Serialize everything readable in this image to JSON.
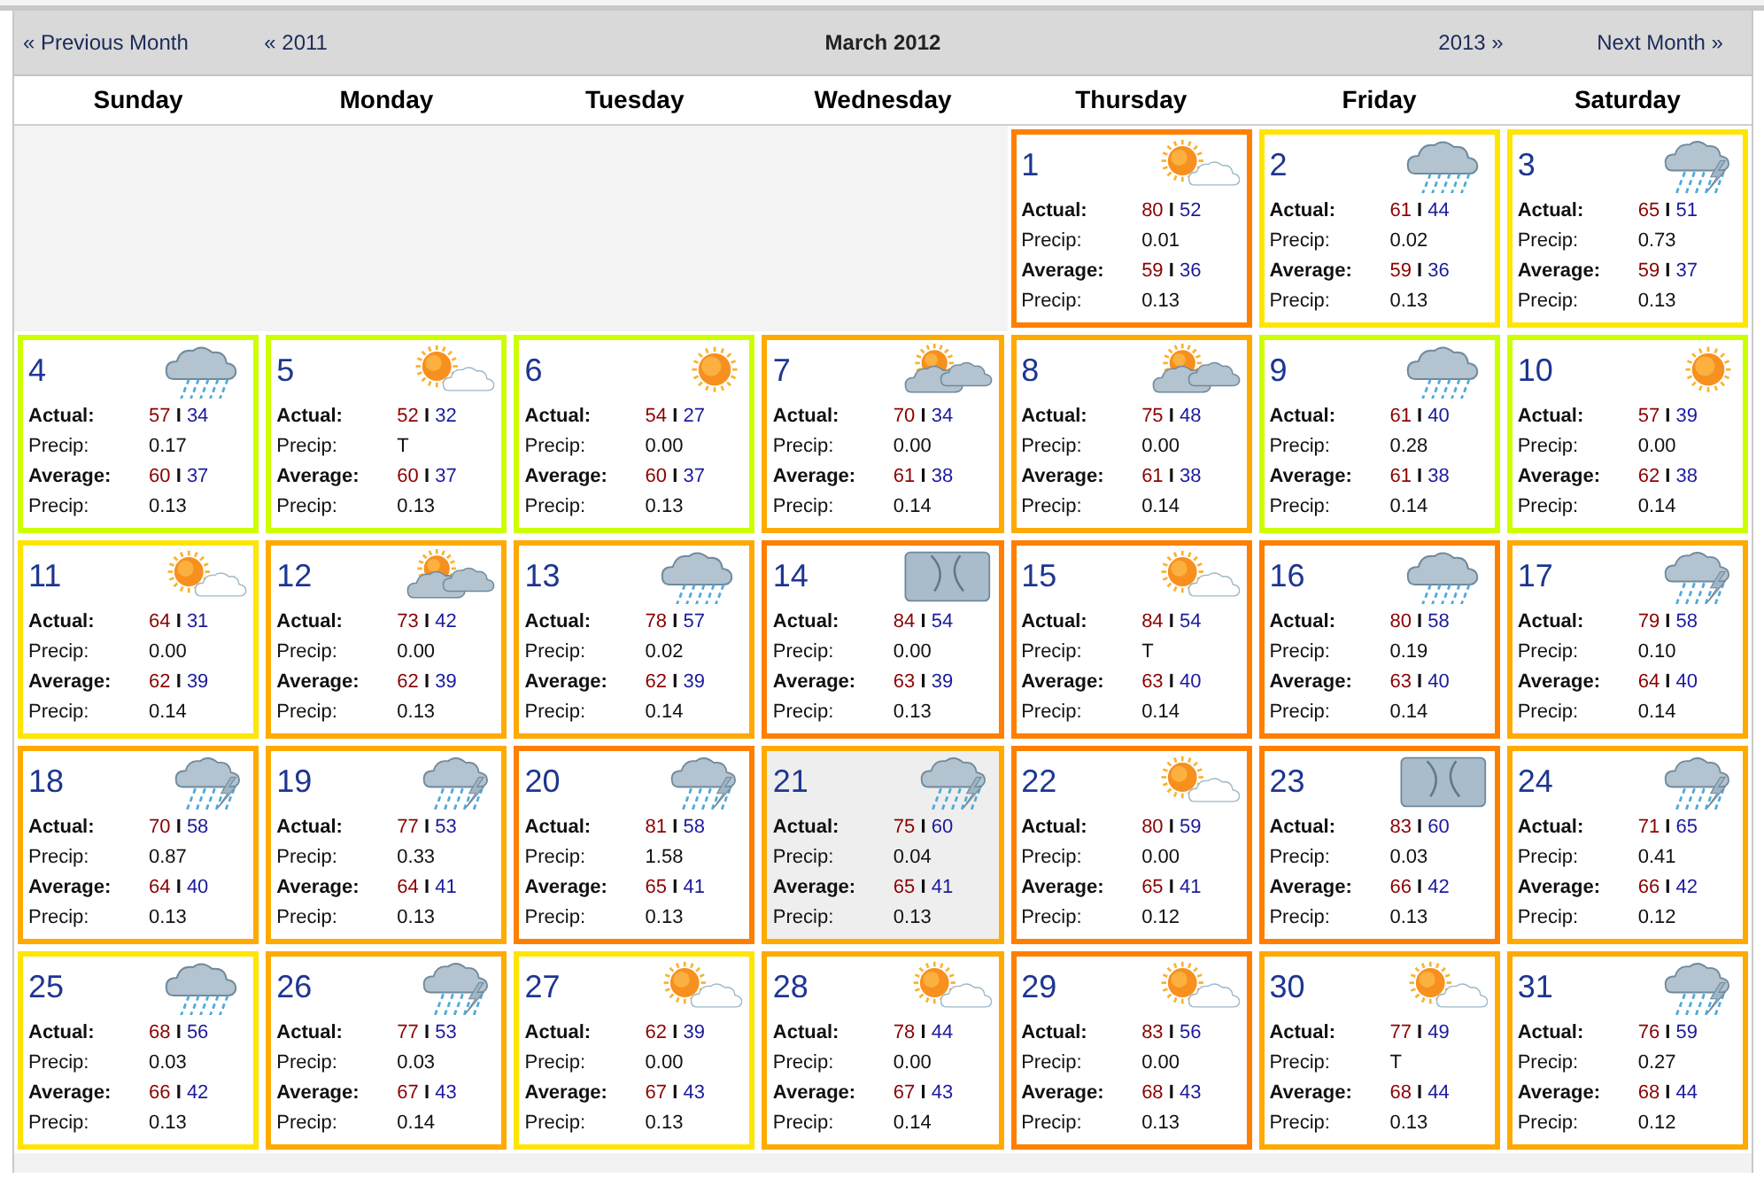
{
  "nav": {
    "prev_month": "« Previous Month",
    "prev_year": "« 2011",
    "title": "March 2012",
    "next_year": "2013 »",
    "next_month": "Next Month »"
  },
  "weekdays": [
    "Sunday",
    "Monday",
    "Tuesday",
    "Wednesday",
    "Thursday",
    "Friday",
    "Saturday"
  ],
  "cells": [
    {
      "kind": "blank"
    },
    {
      "kind": "blank"
    },
    {
      "kind": "blank"
    },
    {
      "kind": "blank"
    },
    {
      "kind": "sun-cloud",
      "day": "1",
      "color": "#ff7f00",
      "selected": false,
      "rows": [
        {
          "kind": "temps",
          "label": "Actual:",
          "hi": "80",
          "sep": "I",
          "lo": "52"
        },
        {
          "kind": "precip",
          "label": "Precip:",
          "value": "0.01"
        },
        {
          "kind": "temps",
          "label": "Average:",
          "hi": "59",
          "sep": "I",
          "lo": "36"
        },
        {
          "kind": "precip",
          "label": "Precip:",
          "value": "0.13"
        }
      ]
    },
    {
      "kind": "rain",
      "day": "2",
      "color": "#ffe500",
      "selected": false,
      "rows": [
        {
          "kind": "temps",
          "label": "Actual:",
          "hi": "61",
          "sep": "I",
          "lo": "44"
        },
        {
          "kind": "precip",
          "label": "Precip:",
          "value": "0.02"
        },
        {
          "kind": "temps",
          "label": "Average:",
          "hi": "59",
          "sep": "I",
          "lo": "36"
        },
        {
          "kind": "precip",
          "label": "Precip:",
          "value": "0.13"
        }
      ]
    },
    {
      "kind": "storm",
      "day": "3",
      "color": "#ffe500",
      "selected": false,
      "rows": [
        {
          "kind": "temps",
          "label": "Actual:",
          "hi": "65",
          "sep": "I",
          "lo": "51"
        },
        {
          "kind": "precip",
          "label": "Precip:",
          "value": "0.73"
        },
        {
          "kind": "temps",
          "label": "Average:",
          "hi": "59",
          "sep": "I",
          "lo": "37"
        },
        {
          "kind": "precip",
          "label": "Precip:",
          "value": "0.13"
        }
      ]
    },
    {
      "kind": "rain",
      "day": "4",
      "color": "#ccff00",
      "selected": false,
      "rows": [
        {
          "kind": "temps",
          "label": "Actual:",
          "hi": "57",
          "sep": "I",
          "lo": "34"
        },
        {
          "kind": "precip",
          "label": "Precip:",
          "value": "0.17"
        },
        {
          "kind": "temps",
          "label": "Average:",
          "hi": "60",
          "sep": "I",
          "lo": "37"
        },
        {
          "kind": "precip",
          "label": "Precip:",
          "value": "0.13"
        }
      ]
    },
    {
      "kind": "sun-cloud",
      "day": "5",
      "color": "#ccff00",
      "selected": false,
      "rows": [
        {
          "kind": "temps",
          "label": "Actual:",
          "hi": "52",
          "sep": "I",
          "lo": "32"
        },
        {
          "kind": "precip",
          "label": "Precip:",
          "value": "T"
        },
        {
          "kind": "temps",
          "label": "Average:",
          "hi": "60",
          "sep": "I",
          "lo": "37"
        },
        {
          "kind": "precip",
          "label": "Precip:",
          "value": "0.13"
        }
      ]
    },
    {
      "kind": "sun",
      "day": "6",
      "color": "#ccff00",
      "selected": false,
      "rows": [
        {
          "kind": "temps",
          "label": "Actual:",
          "hi": "54",
          "sep": "I",
          "lo": "27"
        },
        {
          "kind": "precip",
          "label": "Precip:",
          "value": "0.00"
        },
        {
          "kind": "temps",
          "label": "Average:",
          "hi": "60",
          "sep": "I",
          "lo": "37"
        },
        {
          "kind": "precip",
          "label": "Precip:",
          "value": "0.13"
        }
      ]
    },
    {
      "kind": "partly-cloudy",
      "day": "7",
      "color": "#ffaa00",
      "selected": false,
      "rows": [
        {
          "kind": "temps",
          "label": "Actual:",
          "hi": "70",
          "sep": "I",
          "lo": "34"
        },
        {
          "kind": "precip",
          "label": "Precip:",
          "value": "0.00"
        },
        {
          "kind": "temps",
          "label": "Average:",
          "hi": "61",
          "sep": "I",
          "lo": "38"
        },
        {
          "kind": "precip",
          "label": "Precip:",
          "value": "0.14"
        }
      ]
    },
    {
      "kind": "partly-cloudy",
      "day": "8",
      "color": "#ffaa00",
      "selected": false,
      "rows": [
        {
          "kind": "temps",
          "label": "Actual:",
          "hi": "75",
          "sep": "I",
          "lo": "48"
        },
        {
          "kind": "precip",
          "label": "Precip:",
          "value": "0.00"
        },
        {
          "kind": "temps",
          "label": "Average:",
          "hi": "61",
          "sep": "I",
          "lo": "38"
        },
        {
          "kind": "precip",
          "label": "Precip:",
          "value": "0.14"
        }
      ]
    },
    {
      "kind": "rain",
      "day": "9",
      "color": "#ccff00",
      "selected": false,
      "rows": [
        {
          "kind": "temps",
          "label": "Actual:",
          "hi": "61",
          "sep": "I",
          "lo": "40"
        },
        {
          "kind": "precip",
          "label": "Precip:",
          "value": "0.28"
        },
        {
          "kind": "temps",
          "label": "Average:",
          "hi": "61",
          "sep": "I",
          "lo": "38"
        },
        {
          "kind": "precip",
          "label": "Precip:",
          "value": "0.14"
        }
      ]
    },
    {
      "kind": "sun",
      "day": "10",
      "color": "#ccff00",
      "selected": false,
      "rows": [
        {
          "kind": "temps",
          "label": "Actual:",
          "hi": "57",
          "sep": "I",
          "lo": "39"
        },
        {
          "kind": "precip",
          "label": "Precip:",
          "value": "0.00"
        },
        {
          "kind": "temps",
          "label": "Average:",
          "hi": "62",
          "sep": "I",
          "lo": "38"
        },
        {
          "kind": "precip",
          "label": "Precip:",
          "value": "0.14"
        }
      ]
    },
    {
      "kind": "sun-cloud",
      "day": "11",
      "color": "#ffe500",
      "selected": false,
      "rows": [
        {
          "kind": "temps",
          "label": "Actual:",
          "hi": "64",
          "sep": "I",
          "lo": "31"
        },
        {
          "kind": "precip",
          "label": "Precip:",
          "value": "0.00"
        },
        {
          "kind": "temps",
          "label": "Average:",
          "hi": "62",
          "sep": "I",
          "lo": "39"
        },
        {
          "kind": "precip",
          "label": "Precip:",
          "value": "0.14"
        }
      ]
    },
    {
      "kind": "partly-cloudy",
      "day": "12",
      "color": "#ffaa00",
      "selected": false,
      "rows": [
        {
          "kind": "temps",
          "label": "Actual:",
          "hi": "73",
          "sep": "I",
          "lo": "42"
        },
        {
          "kind": "precip",
          "label": "Precip:",
          "value": "0.00"
        },
        {
          "kind": "temps",
          "label": "Average:",
          "hi": "62",
          "sep": "I",
          "lo": "39"
        },
        {
          "kind": "precip",
          "label": "Precip:",
          "value": "0.13"
        }
      ]
    },
    {
      "kind": "rain",
      "day": "13",
      "color": "#ffaa00",
      "selected": false,
      "rows": [
        {
          "kind": "temps",
          "label": "Actual:",
          "hi": "78",
          "sep": "I",
          "lo": "57"
        },
        {
          "kind": "precip",
          "label": "Precip:",
          "value": "0.02"
        },
        {
          "kind": "temps",
          "label": "Average:",
          "hi": "62",
          "sep": "I",
          "lo": "39"
        },
        {
          "kind": "precip",
          "label": "Precip:",
          "value": "0.14"
        }
      ]
    },
    {
      "kind": "overcast",
      "day": "14",
      "color": "#ff7f00",
      "selected": false,
      "rows": [
        {
          "kind": "temps",
          "label": "Actual:",
          "hi": "84",
          "sep": "I",
          "lo": "54"
        },
        {
          "kind": "precip",
          "label": "Precip:",
          "value": "0.00"
        },
        {
          "kind": "temps",
          "label": "Average:",
          "hi": "63",
          "sep": "I",
          "lo": "39"
        },
        {
          "kind": "precip",
          "label": "Precip:",
          "value": "0.13"
        }
      ]
    },
    {
      "kind": "sun-cloud",
      "day": "15",
      "color": "#ff7f00",
      "selected": false,
      "rows": [
        {
          "kind": "temps",
          "label": "Actual:",
          "hi": "84",
          "sep": "I",
          "lo": "54"
        },
        {
          "kind": "precip",
          "label": "Precip:",
          "value": "T"
        },
        {
          "kind": "temps",
          "label": "Average:",
          "hi": "63",
          "sep": "I",
          "lo": "40"
        },
        {
          "kind": "precip",
          "label": "Precip:",
          "value": "0.14"
        }
      ]
    },
    {
      "kind": "rain",
      "day": "16",
      "color": "#ff7f00",
      "selected": false,
      "rows": [
        {
          "kind": "temps",
          "label": "Actual:",
          "hi": "80",
          "sep": "I",
          "lo": "58"
        },
        {
          "kind": "precip",
          "label": "Precip:",
          "value": "0.19"
        },
        {
          "kind": "temps",
          "label": "Average:",
          "hi": "63",
          "sep": "I",
          "lo": "40"
        },
        {
          "kind": "precip",
          "label": "Precip:",
          "value": "0.14"
        }
      ]
    },
    {
      "kind": "storm",
      "day": "17",
      "color": "#ffaa00",
      "selected": false,
      "rows": [
        {
          "kind": "temps",
          "label": "Actual:",
          "hi": "79",
          "sep": "I",
          "lo": "58"
        },
        {
          "kind": "precip",
          "label": "Precip:",
          "value": "0.10"
        },
        {
          "kind": "temps",
          "label": "Average:",
          "hi": "64",
          "sep": "I",
          "lo": "40"
        },
        {
          "kind": "precip",
          "label": "Precip:",
          "value": "0.14"
        }
      ]
    },
    {
      "kind": "storm",
      "day": "18",
      "color": "#ffaa00",
      "selected": false,
      "rows": [
        {
          "kind": "temps",
          "label": "Actual:",
          "hi": "70",
          "sep": "I",
          "lo": "58"
        },
        {
          "kind": "precip",
          "label": "Precip:",
          "value": "0.87"
        },
        {
          "kind": "temps",
          "label": "Average:",
          "hi": "64",
          "sep": "I",
          "lo": "40"
        },
        {
          "kind": "precip",
          "label": "Precip:",
          "value": "0.13"
        }
      ]
    },
    {
      "kind": "storm",
      "day": "19",
      "color": "#ffaa00",
      "selected": false,
      "rows": [
        {
          "kind": "temps",
          "label": "Actual:",
          "hi": "77",
          "sep": "I",
          "lo": "53"
        },
        {
          "kind": "precip",
          "label": "Precip:",
          "value": "0.33"
        },
        {
          "kind": "temps",
          "label": "Average:",
          "hi": "64",
          "sep": "I",
          "lo": "41"
        },
        {
          "kind": "precip",
          "label": "Precip:",
          "value": "0.13"
        }
      ]
    },
    {
      "kind": "storm",
      "day": "20",
      "color": "#ff7f00",
      "selected": false,
      "rows": [
        {
          "kind": "temps",
          "label": "Actual:",
          "hi": "81",
          "sep": "I",
          "lo": "58"
        },
        {
          "kind": "precip",
          "label": "Precip:",
          "value": "1.58"
        },
        {
          "kind": "temps",
          "label": "Average:",
          "hi": "65",
          "sep": "I",
          "lo": "41"
        },
        {
          "kind": "precip",
          "label": "Precip:",
          "value": "0.13"
        }
      ]
    },
    {
      "kind": "storm",
      "day": "21",
      "color": "#ffaa00",
      "selected": true,
      "rows": [
        {
          "kind": "temps",
          "label": "Actual:",
          "hi": "75",
          "sep": "I",
          "lo": "60"
        },
        {
          "kind": "precip",
          "label": "Precip:",
          "value": "0.04"
        },
        {
          "kind": "temps",
          "label": "Average:",
          "hi": "65",
          "sep": "I",
          "lo": "41"
        },
        {
          "kind": "precip",
          "label": "Precip:",
          "value": "0.13"
        }
      ]
    },
    {
      "kind": "sun-cloud",
      "day": "22",
      "color": "#ff7f00",
      "selected": false,
      "rows": [
        {
          "kind": "temps",
          "label": "Actual:",
          "hi": "80",
          "sep": "I",
          "lo": "59"
        },
        {
          "kind": "precip",
          "label": "Precip:",
          "value": "0.00"
        },
        {
          "kind": "temps",
          "label": "Average:",
          "hi": "65",
          "sep": "I",
          "lo": "41"
        },
        {
          "kind": "precip",
          "label": "Precip:",
          "value": "0.12"
        }
      ]
    },
    {
      "kind": "overcast",
      "day": "23",
      "color": "#ff7f00",
      "selected": false,
      "rows": [
        {
          "kind": "temps",
          "label": "Actual:",
          "hi": "83",
          "sep": "I",
          "lo": "60"
        },
        {
          "kind": "precip",
          "label": "Precip:",
          "value": "0.03"
        },
        {
          "kind": "temps",
          "label": "Average:",
          "hi": "66",
          "sep": "I",
          "lo": "42"
        },
        {
          "kind": "precip",
          "label": "Precip:",
          "value": "0.13"
        }
      ]
    },
    {
      "kind": "storm",
      "day": "24",
      "color": "#ffaa00",
      "selected": false,
      "rows": [
        {
          "kind": "temps",
          "label": "Actual:",
          "hi": "71",
          "sep": "I",
          "lo": "65"
        },
        {
          "kind": "precip",
          "label": "Precip:",
          "value": "0.41"
        },
        {
          "kind": "temps",
          "label": "Average:",
          "hi": "66",
          "sep": "I",
          "lo": "42"
        },
        {
          "kind": "precip",
          "label": "Precip:",
          "value": "0.12"
        }
      ]
    },
    {
      "kind": "rain",
      "day": "25",
      "color": "#ffe500",
      "selected": false,
      "rows": [
        {
          "kind": "temps",
          "label": "Actual:",
          "hi": "68",
          "sep": "I",
          "lo": "56"
        },
        {
          "kind": "precip",
          "label": "Precip:",
          "value": "0.03"
        },
        {
          "kind": "temps",
          "label": "Average:",
          "hi": "66",
          "sep": "I",
          "lo": "42"
        },
        {
          "kind": "precip",
          "label": "Precip:",
          "value": "0.13"
        }
      ]
    },
    {
      "kind": "storm",
      "day": "26",
      "color": "#ffaa00",
      "selected": false,
      "rows": [
        {
          "kind": "temps",
          "label": "Actual:",
          "hi": "77",
          "sep": "I",
          "lo": "53"
        },
        {
          "kind": "precip",
          "label": "Precip:",
          "value": "0.03"
        },
        {
          "kind": "temps",
          "label": "Average:",
          "hi": "67",
          "sep": "I",
          "lo": "43"
        },
        {
          "kind": "precip",
          "label": "Precip:",
          "value": "0.14"
        }
      ]
    },
    {
      "kind": "sun-cloud",
      "day": "27",
      "color": "#ffe500",
      "selected": false,
      "rows": [
        {
          "kind": "temps",
          "label": "Actual:",
          "hi": "62",
          "sep": "I",
          "lo": "39"
        },
        {
          "kind": "precip",
          "label": "Precip:",
          "value": "0.00"
        },
        {
          "kind": "temps",
          "label": "Average:",
          "hi": "67",
          "sep": "I",
          "lo": "43"
        },
        {
          "kind": "precip",
          "label": "Precip:",
          "value": "0.13"
        }
      ]
    },
    {
      "kind": "sun-cloud",
      "day": "28",
      "color": "#ffaa00",
      "selected": false,
      "rows": [
        {
          "kind": "temps",
          "label": "Actual:",
          "hi": "78",
          "sep": "I",
          "lo": "44"
        },
        {
          "kind": "precip",
          "label": "Precip:",
          "value": "0.00"
        },
        {
          "kind": "temps",
          "label": "Average:",
          "hi": "67",
          "sep": "I",
          "lo": "43"
        },
        {
          "kind": "precip",
          "label": "Precip:",
          "value": "0.14"
        }
      ]
    },
    {
      "kind": "sun-cloud",
      "day": "29",
      "color": "#ff7f00",
      "selected": false,
      "rows": [
        {
          "kind": "temps",
          "label": "Actual:",
          "hi": "83",
          "sep": "I",
          "lo": "56"
        },
        {
          "kind": "precip",
          "label": "Precip:",
          "value": "0.00"
        },
        {
          "kind": "temps",
          "label": "Average:",
          "hi": "68",
          "sep": "I",
          "lo": "43"
        },
        {
          "kind": "precip",
          "label": "Precip:",
          "value": "0.13"
        }
      ]
    },
    {
      "kind": "sun-cloud",
      "day": "30",
      "color": "#ffaa00",
      "selected": false,
      "rows": [
        {
          "kind": "temps",
          "label": "Actual:",
          "hi": "77",
          "sep": "I",
          "lo": "49"
        },
        {
          "kind": "precip",
          "label": "Precip:",
          "value": "T"
        },
        {
          "kind": "temps",
          "label": "Average:",
          "hi": "68",
          "sep": "I",
          "lo": "44"
        },
        {
          "kind": "precip",
          "label": "Precip:",
          "value": "0.13"
        }
      ]
    },
    {
      "kind": "storm",
      "day": "31",
      "color": "#ffaa00",
      "selected": false,
      "rows": [
        {
          "kind": "temps",
          "label": "Actual:",
          "hi": "76",
          "sep": "I",
          "lo": "59"
        },
        {
          "kind": "precip",
          "label": "Precip:",
          "value": "0.27"
        },
        {
          "kind": "temps",
          "label": "Average:",
          "hi": "68",
          "sep": "I",
          "lo": "44"
        },
        {
          "kind": "precip",
          "label": "Precip:",
          "value": "0.12"
        }
      ]
    }
  ]
}
